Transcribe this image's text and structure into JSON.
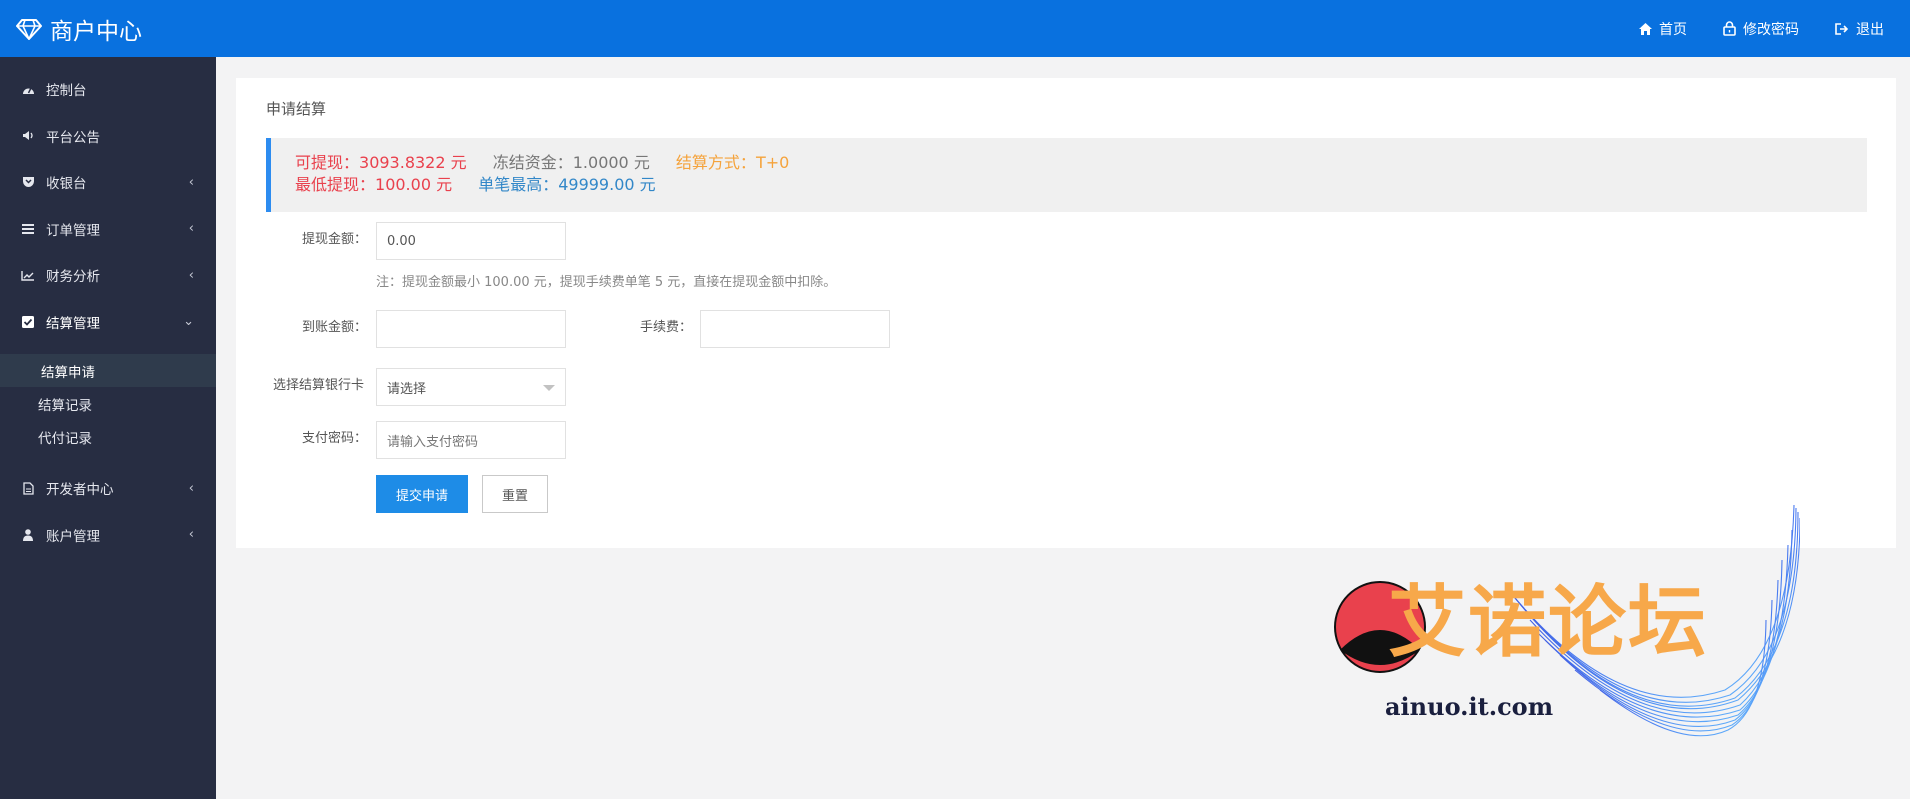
{
  "header": {
    "brand": "商户中心",
    "nav": [
      {
        "label": "首页",
        "icon": "home-icon"
      },
      {
        "label": "修改密码",
        "icon": "lock-icon"
      },
      {
        "label": "退出",
        "icon": "logout-icon"
      }
    ]
  },
  "sidebar": {
    "items": [
      {
        "label": "控制台",
        "icon": "dashboard-icon"
      },
      {
        "label": "平台公告",
        "icon": "speaker-icon"
      },
      {
        "label": "收银台",
        "icon": "shield-icon",
        "caret": "‹"
      },
      {
        "label": "订单管理",
        "icon": "list-icon",
        "caret": "‹"
      },
      {
        "label": "财务分析",
        "icon": "line-chart-icon",
        "caret": "‹"
      },
      {
        "label": "结算管理",
        "icon": "checkbox-icon",
        "caret": "⌄"
      },
      {
        "label": "开发者中心",
        "icon": "document-icon",
        "caret": "‹"
      },
      {
        "label": "账户管理",
        "icon": "user-icon",
        "caret": "‹"
      }
    ],
    "submenu": [
      {
        "label": "结算申请",
        "active": true
      },
      {
        "label": "结算记录",
        "active": false
      },
      {
        "label": "代付记录",
        "active": false
      }
    ]
  },
  "main": {
    "title": "申请结算",
    "info": {
      "available_label": "可提现：",
      "available_value": "3093.8322 元",
      "frozen_label": "冻结资金：",
      "frozen_value": "1.0000 元",
      "method_label": "结算方式：",
      "method_value": "T+0",
      "min_label": "最低提现：",
      "min_value": "100.00 元",
      "max_label": "单笔最高：",
      "max_value": "49999.00 元"
    },
    "form": {
      "amount_label": "提现金额：",
      "amount_value": "0.00",
      "hint": "注：提现金额最小 100.00 元，提现手续费单笔 5 元，直接在提现金额中扣除。",
      "received_label": "到账金额：",
      "received_value": "",
      "fee_label": "手续费：",
      "fee_value": "",
      "bank_label": "选择结算银行卡",
      "bank_selected": "请选择",
      "password_label": "支付密码：",
      "password_placeholder": "请输入支付密码",
      "submit_label": "提交申请",
      "reset_label": "重置"
    }
  },
  "watermark": {
    "text": "艾诺论坛",
    "url": "ainuo.it.com"
  },
  "colors": {
    "header_bg": "#0971df",
    "sidebar_bg": "#272d42",
    "primary": "#1e8ce7",
    "red": "#e9414d",
    "orange": "#f5a33c",
    "blue": "#3287c8"
  }
}
